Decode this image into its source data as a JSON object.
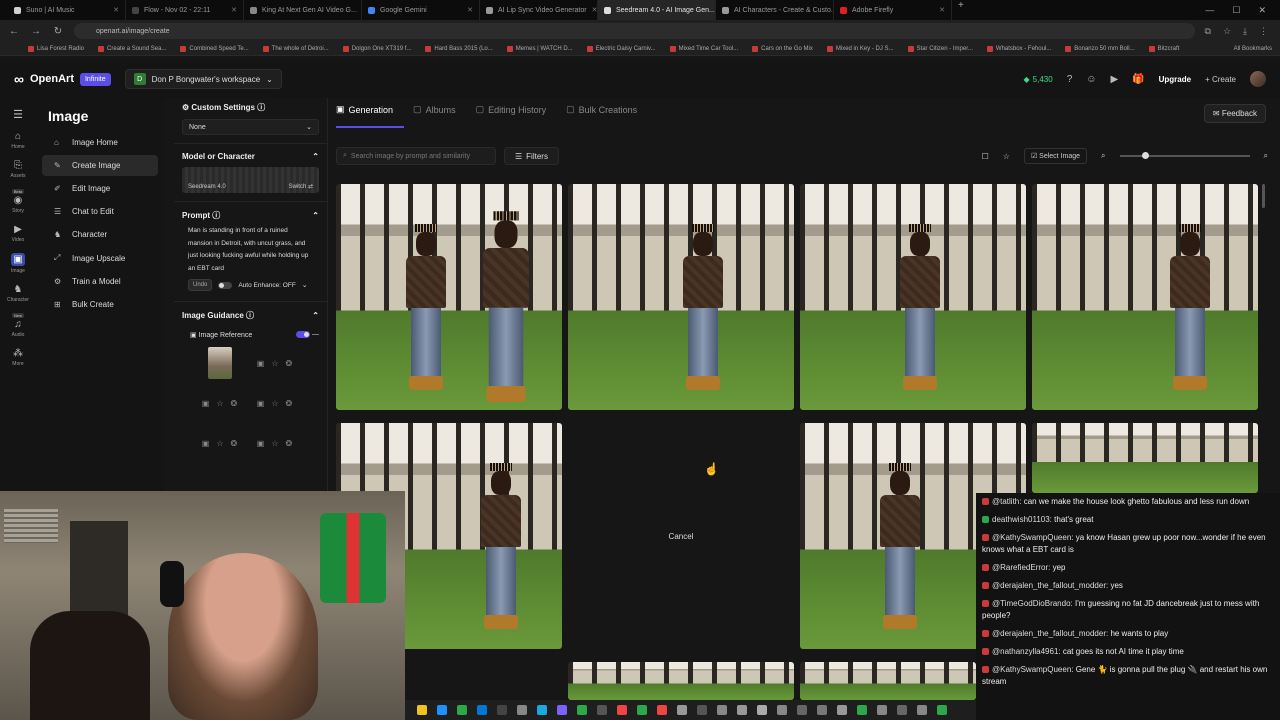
{
  "browser": {
    "tabs": [
      {
        "label": "Suno | AI Music",
        "color": "#d0d0d0"
      },
      {
        "label": "Flow - Nov 02 - 22:11",
        "color": "#444"
      },
      {
        "label": "King At Next Gen AI Video G...",
        "color": "#888"
      },
      {
        "label": "Google Gemini",
        "color": "#4285f4"
      },
      {
        "label": "AI Lip Sync Video Generator",
        "color": "#999"
      },
      {
        "label": "Seedream 4.0 - AI Image Gen...",
        "color": "#ddd",
        "active": true
      },
      {
        "label": "AI Characters - Create & Custo...",
        "color": "#999"
      },
      {
        "label": "Adobe Firefly",
        "color": "#e02020"
      }
    ],
    "url": "openart.ai/image/create",
    "bookmarks": [
      "Lisa Forest Radio",
      "Create a Sound Sea...",
      "Combined Speed Te...",
      "The whole of Detroi...",
      "Dolgon One XT319 f...",
      "Hard Bass 2015 (Lo...",
      "Memes | WATCH D...",
      "Electric Daisy Carniv...",
      "Mixed Time Car Tool...",
      "Cars on the Go Mix",
      "Mixed in Key - DJ S...",
      "Star Citizen - Imper...",
      "Whatsbox - Fehoul...",
      "Bonanzo 50 mm Boll...",
      "Bitzcraft"
    ],
    "bookmarks_right": "All Bookmarks"
  },
  "header": {
    "brand": "OpenArt",
    "plan_badge": "Infinite",
    "workspace_initial": "D",
    "workspace": "Don P Bongwater's workspace",
    "credits": "5,430",
    "upgrade": "Upgrade",
    "create": "Create"
  },
  "rail": [
    {
      "icon": "⌂",
      "label": "Home"
    },
    {
      "icon": "⎘",
      "label": "Assets"
    },
    {
      "icon": "◉",
      "label": "Story",
      "badge": "Beta"
    },
    {
      "icon": "▶",
      "label": "Video"
    },
    {
      "icon": "▣",
      "label": "Image",
      "active": true
    },
    {
      "icon": "♞",
      "label": "Character"
    },
    {
      "icon": "♫",
      "label": "Audio",
      "badge": "New"
    },
    {
      "icon": "⁂",
      "label": "More"
    }
  ],
  "nav": {
    "title": "Image",
    "items": [
      {
        "icon": "⌂",
        "label": "Image Home"
      },
      {
        "icon": "✎",
        "label": "Create Image",
        "selected": true
      },
      {
        "icon": "✐",
        "label": "Edit Image"
      },
      {
        "icon": "☰",
        "label": "Chat to Edit"
      },
      {
        "icon": "♞",
        "label": "Character"
      },
      {
        "icon": "⤢",
        "label": "Image Upscale"
      },
      {
        "icon": "⚙",
        "label": "Train a Model"
      },
      {
        "icon": "⊞",
        "label": "Bulk Create"
      }
    ]
  },
  "settings": {
    "custom_settings": "Custom Settings",
    "custom_value": "None",
    "model_title": "Model or Character",
    "model_name": "Seedream 4.0",
    "switch_label": "Switch",
    "prompt_title": "Prompt",
    "prompt_text": "Man is standing in front of a ruined mansion in Detroit, with uncut grass, and just looking fucking awful while holding up an EBT card",
    "undo": "Undo",
    "auto_enhance": "Auto Enhance: OFF",
    "guidance_title": "Image Guidance",
    "image_reference": "Image Reference"
  },
  "main": {
    "tabs": [
      "Generation",
      "Albums",
      "Editing History",
      "Bulk Creations"
    ],
    "feedback": "Feedback",
    "search_placeholder": "Search image by prompt and similarity",
    "filters": "Filters",
    "select_image": "Select Image",
    "cancel": "Cancel"
  },
  "chat": [
    {
      "name": "@tatlith:",
      "text": "can we make the house look ghetto fabulous and less run down"
    },
    {
      "name": "deathwish01103:",
      "text": "that's great",
      "green": true
    },
    {
      "name": "@KathySwampQueen:",
      "text": "ya know Hasan grew up poor now...wonder if he even knows what a EBT card is"
    },
    {
      "name": "@RarefiedError:",
      "text": "yep"
    },
    {
      "name": "@derajalen_the_fallout_modder:",
      "text": "yes"
    },
    {
      "name": "@TimeGodDioBrando:",
      "text": "I'm guessing no fat JD dancebreak just to mess with people?"
    },
    {
      "name": "@derajalen_the_fallout_modder:",
      "text": "he wants to play"
    },
    {
      "name": "@nathanzylla4961:",
      "text": "cat goes its not AI time it play time"
    },
    {
      "name": "@KathySwampQueen:",
      "text": "Gene 🐈 is gonna pull the plug 🔌 and restart his own stream"
    }
  ],
  "colors": {
    "accent": "#5b4ee8",
    "credits": "#3ddc84"
  }
}
